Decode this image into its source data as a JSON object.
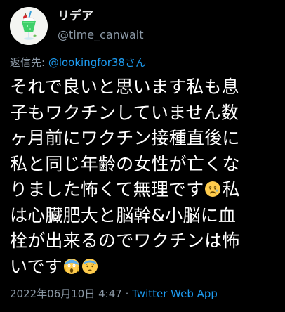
{
  "user": {
    "display_name": "リデア",
    "handle": "@time_canwait",
    "avatar_icon": "cream-soda-glass-icon"
  },
  "reply": {
    "prefix": "返信先: ",
    "target": "@lookingfor38さん"
  },
  "tweet": {
    "lines": [
      "それで良いと思います私も息",
      "子もワクチンしていません数",
      "ヶ月前にワクチン接種直後に",
      "私と同じ年齢の女性が亡くな",
      "りました怖くて無理です",
      "私",
      "は心臓肥大と脳幹&小脳に血",
      "栓が出来るのでワクチンは怖",
      "いです"
    ],
    "emojis": [
      "sad-but-relieved-face-emoji",
      "screaming-in-fear-face-emoji",
      "fearful-face-emoji"
    ]
  },
  "meta": {
    "timestamp": "2022年06月10日 4:47",
    "separator": " · ",
    "source": "Twitter Web App"
  },
  "colors": {
    "background": "#000000",
    "text": "#ffffff",
    "secondary": "#8b98a5",
    "link": "#1d9bf0"
  }
}
